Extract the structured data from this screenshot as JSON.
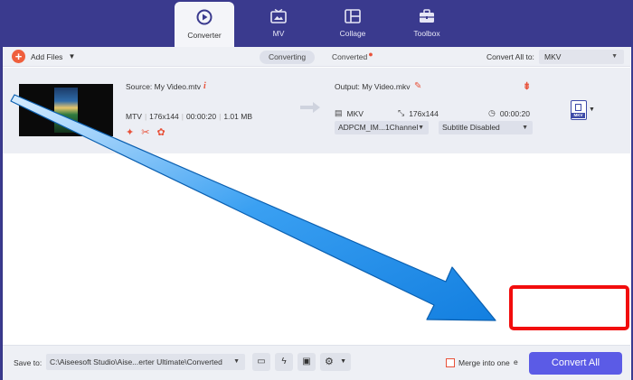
{
  "nav": {
    "tabs": [
      {
        "label": "Converter",
        "icon": "converter-icon",
        "active": true
      },
      {
        "label": "MV",
        "icon": "tv-icon"
      },
      {
        "label": "Collage",
        "icon": "collage-icon"
      },
      {
        "label": "Toolbox",
        "icon": "toolbox-icon"
      }
    ]
  },
  "toolbar": {
    "add_files_label": "Add Files",
    "tab_converting": "Converting",
    "tab_converted": "Converted",
    "convert_all_to_label": "Convert All to:",
    "convert_all_to_value": "MKV"
  },
  "file": {
    "source_label": "Source: My Video.mtv",
    "format": "MTV",
    "resolution": "176x144",
    "duration": "00:00:20",
    "size": "1.01 MB",
    "output_label": "Output: My Video.mkv",
    "out_format": "MKV",
    "out_resolution": "176x144",
    "out_duration": "00:00:20",
    "audio_track": "ADPCM_IM...1Channel",
    "subtitle": "Subtitle Disabled",
    "badge_text": "MKV"
  },
  "bottom": {
    "save_to_label": "Save to:",
    "path": "C:\\Aiseesoft Studio\\Aise...erter Ultimate\\Converted",
    "merge_label": "Merge into one",
    "merge_label_tail": "e",
    "convert_all_label": "Convert All"
  },
  "colors": {
    "nav_bg": "#3a3a8e",
    "accent": "#e8523a",
    "primary_button": "#5b5be6",
    "annotation_arrow": "#1f8ef0",
    "annotation_box": "#f20d0d"
  }
}
